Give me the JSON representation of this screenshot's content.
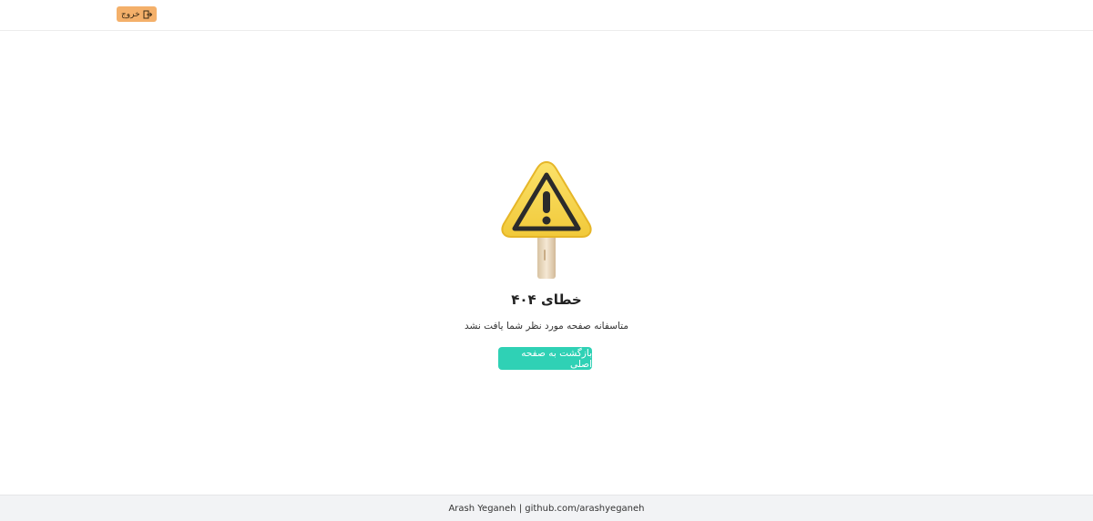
{
  "header": {
    "logout_label": "خروج",
    "logout_icon": "logout-icon"
  },
  "error": {
    "illustration_icon": "warning-sign-icon",
    "title": "خطای ۴۰۴",
    "message": "متاسفانه صفحه مورد نظر شما یافت نشد",
    "home_button_label": "بازگشت به صفحه اصلی"
  },
  "footer": {
    "credit": "Arash Yeganeh | github.com/arashyeganeh"
  },
  "colors": {
    "logout_button": "#f4b06a",
    "home_button": "#2fd1b5",
    "warning_yellow": "#f7d54a",
    "footer_bg": "#f2f3f5"
  }
}
